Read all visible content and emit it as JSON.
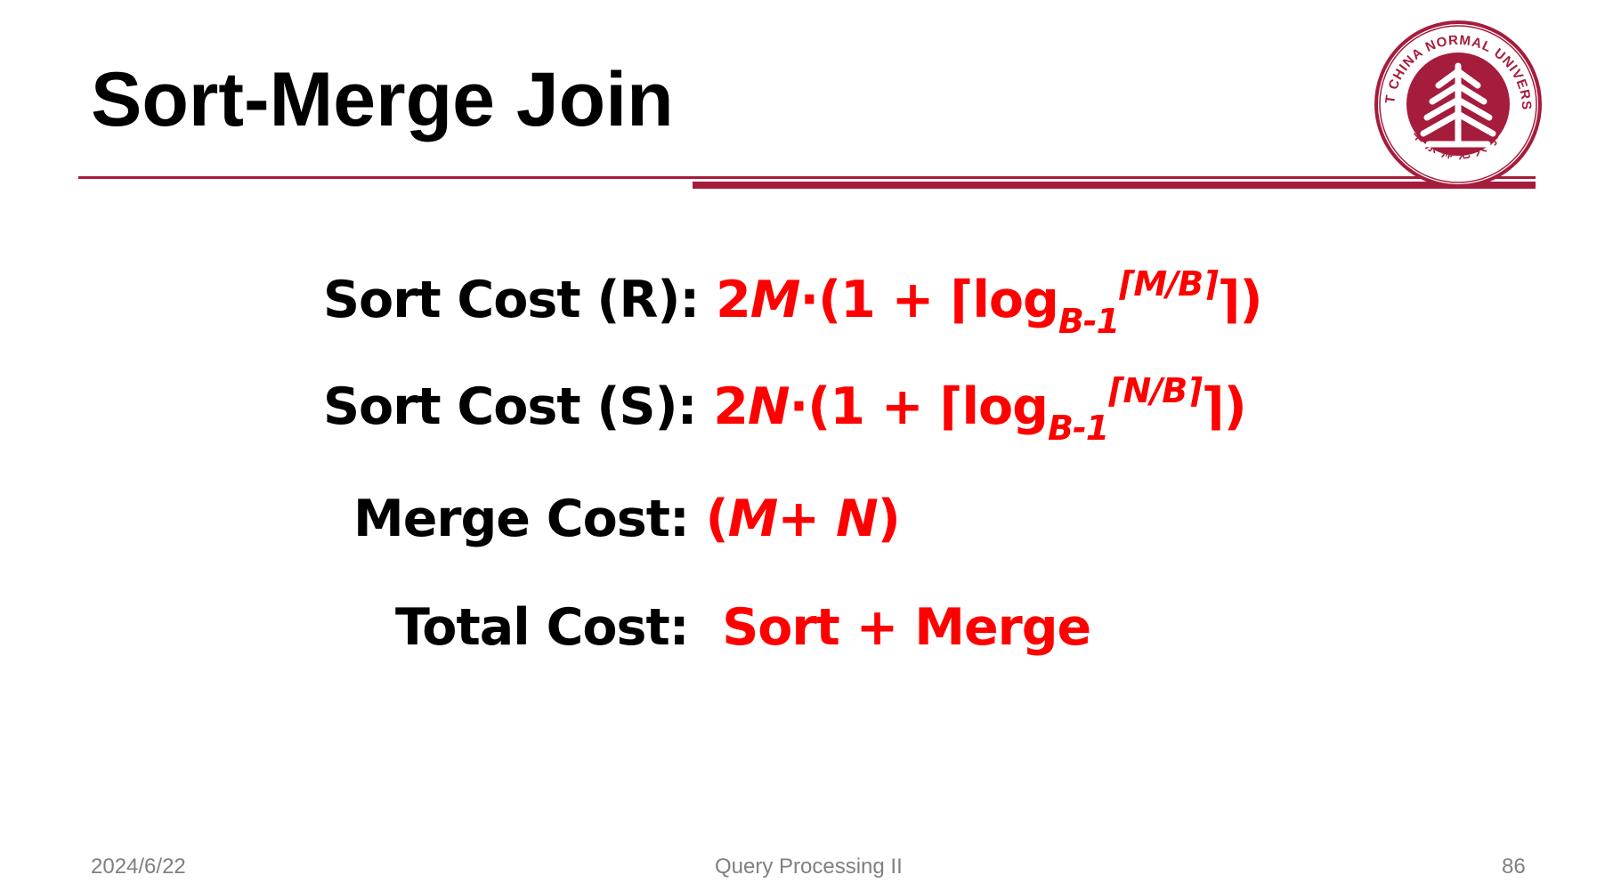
{
  "slide": {
    "title": "Sort-Merge Join"
  },
  "logo": {
    "text_en": "EAST CHINA NORMAL UNIVERSITY",
    "text_zh": "华东师范大学",
    "color": "#a51c3c"
  },
  "formulas": {
    "sort_r": {
      "label": "Sort Cost (R): ",
      "coef": "2",
      "var": "M",
      "mid": "·(1 + ⌈log",
      "sub": "B-1",
      "sup_open": "⌈",
      "sup_var": "M/B",
      "sup_close": "⌉",
      "tail": "⌉)"
    },
    "sort_s": {
      "label": "Sort Cost (S): ",
      "coef": "2",
      "var": "N",
      "mid": "·(1 + ⌈log",
      "sub": "B-1",
      "sup_open": "⌈",
      "sup_var": "N/B",
      "sup_close": "⌉",
      "tail": "⌉)"
    },
    "merge": {
      "label": "Merge Cost: ",
      "open": "(",
      "var1": "M",
      "plus": "+ ",
      "var2": "N",
      "close": ")"
    },
    "total": {
      "label": "Total Cost:  ",
      "value": "Sort + Merge"
    }
  },
  "footer": {
    "date": "2024/6/22",
    "center": "Query Processing II",
    "page_number": "86"
  },
  "colors": {
    "accent": "#a51c3c",
    "formula_red": "#ff0000",
    "footer_gray": "#808080"
  }
}
